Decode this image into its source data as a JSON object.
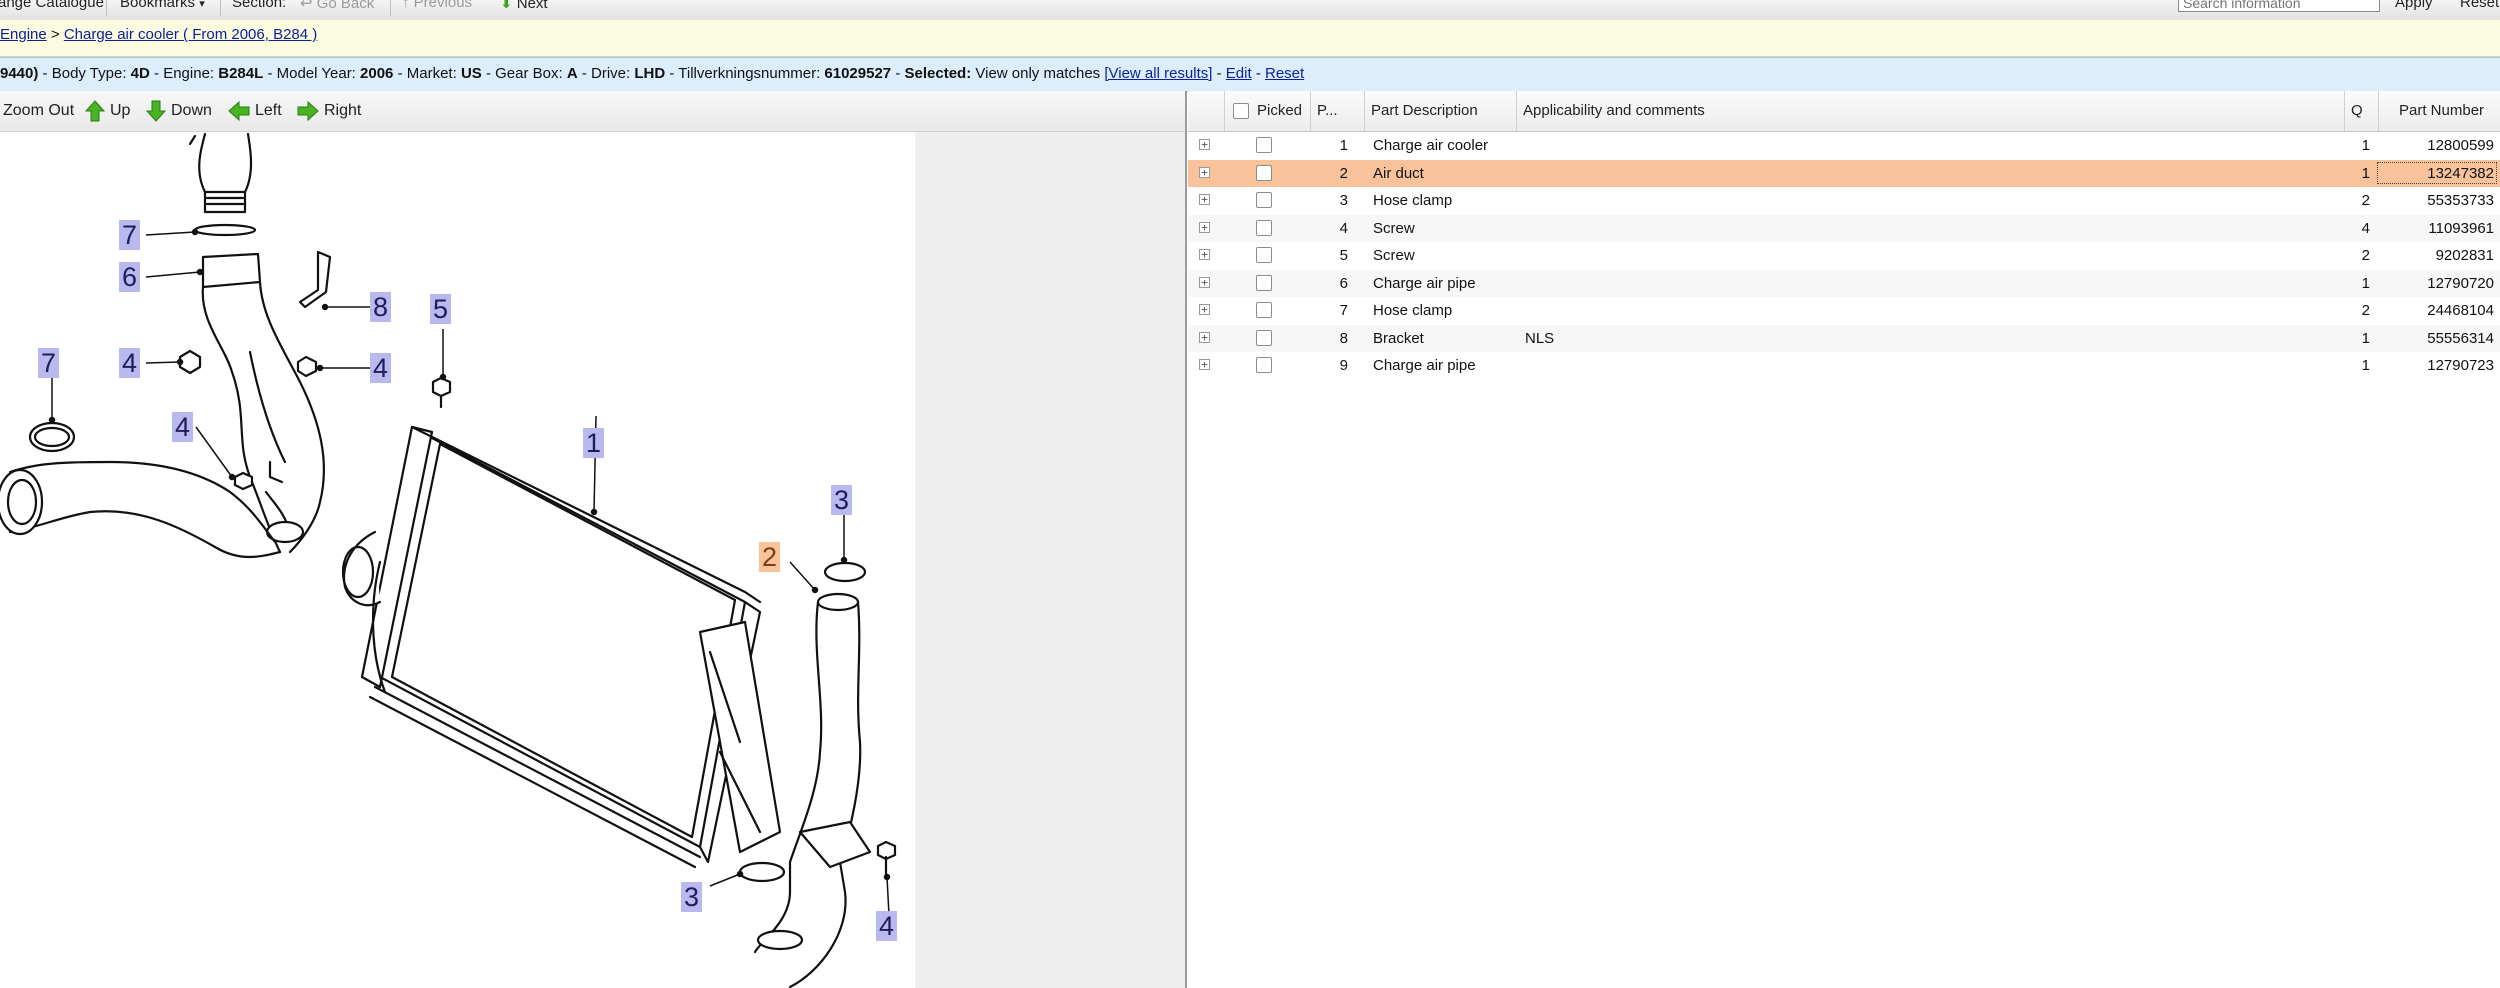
{
  "toolbar": {
    "catalogue": "ange Catalogue",
    "bookmarks": "Bookmarks",
    "section": "Section:",
    "go_back": "Go Back",
    "previous": "Previous",
    "next": "Next",
    "search_placeholder": "Search information",
    "apply": "Apply",
    "reset": "Reset"
  },
  "breadcrumb": {
    "items": [
      "Engine",
      "Charge air cooler ( From 2006, B284 )"
    ],
    "separator": ">"
  },
  "vehicle": {
    "id_fragment": "9440)",
    "body_type_label": "Body Type:",
    "body_type": "4D",
    "engine_label": "Engine:",
    "engine": "B284L",
    "model_year_label": "Model Year:",
    "model_year": "2006",
    "market_label": "Market:",
    "market": "US",
    "gearbox_label": "Gear Box:",
    "gearbox": "A",
    "drive_label": "Drive:",
    "drive": "LHD",
    "tillverkning_label": "Tillverkningsnummer:",
    "tillverkning": "61029527",
    "selected_label": "Selected:",
    "selected_value": "View only matches",
    "view_all": "[View all results]",
    "edit": "Edit",
    "reset": "Reset"
  },
  "nav": {
    "zoom_out": "Zoom Out",
    "up": "Up",
    "down": "Down",
    "left": "Left",
    "right": "Right"
  },
  "callouts": [
    "7",
    "6",
    "8",
    "5",
    "7",
    "4",
    "4",
    "4",
    "1",
    "3",
    "2",
    "3",
    "4"
  ],
  "selected_position": "2",
  "table": {
    "headers": {
      "picked": "Picked",
      "pos": "P...",
      "description": "Part Description",
      "applicability": "Applicability and comments",
      "qty": "Q",
      "part_number": "Part Number"
    },
    "rows": [
      {
        "pos": "1",
        "desc": "Charge air cooler",
        "app": "",
        "qty": "1",
        "pn": "12800599"
      },
      {
        "pos": "2",
        "desc": "Air duct",
        "app": "",
        "qty": "1",
        "pn": "13247382"
      },
      {
        "pos": "3",
        "desc": "Hose clamp",
        "app": "",
        "qty": "2",
        "pn": "55353733"
      },
      {
        "pos": "4",
        "desc": "Screw",
        "app": "",
        "qty": "4",
        "pn": "11093961"
      },
      {
        "pos": "5",
        "desc": "Screw",
        "app": "",
        "qty": "2",
        "pn": "9202831"
      },
      {
        "pos": "6",
        "desc": "Charge air pipe",
        "app": "",
        "qty": "1",
        "pn": "12790720"
      },
      {
        "pos": "7",
        "desc": "Hose clamp",
        "app": "",
        "qty": "2",
        "pn": "24468104"
      },
      {
        "pos": "8",
        "desc": "Bracket",
        "app": "NLS",
        "qty": "1",
        "pn": "55556314"
      },
      {
        "pos": "9",
        "desc": "Charge air pipe",
        "app": "",
        "qty": "1",
        "pn": "12790723"
      }
    ]
  },
  "icons": {
    "expand": "plus-box-icon",
    "up": "green-arrow-up-icon",
    "down": "green-arrow-down-icon",
    "left": "green-arrow-left-icon",
    "right": "green-arrow-right-icon"
  },
  "colors": {
    "selected_row": "#f8c39b",
    "callout": "#b9b9ef",
    "callout_selected": "#f8c39b",
    "vehicle_bar": "#dceefb",
    "breadcrumb_bar": "#fbfbdf",
    "arrow_green": "#3aa51c"
  }
}
